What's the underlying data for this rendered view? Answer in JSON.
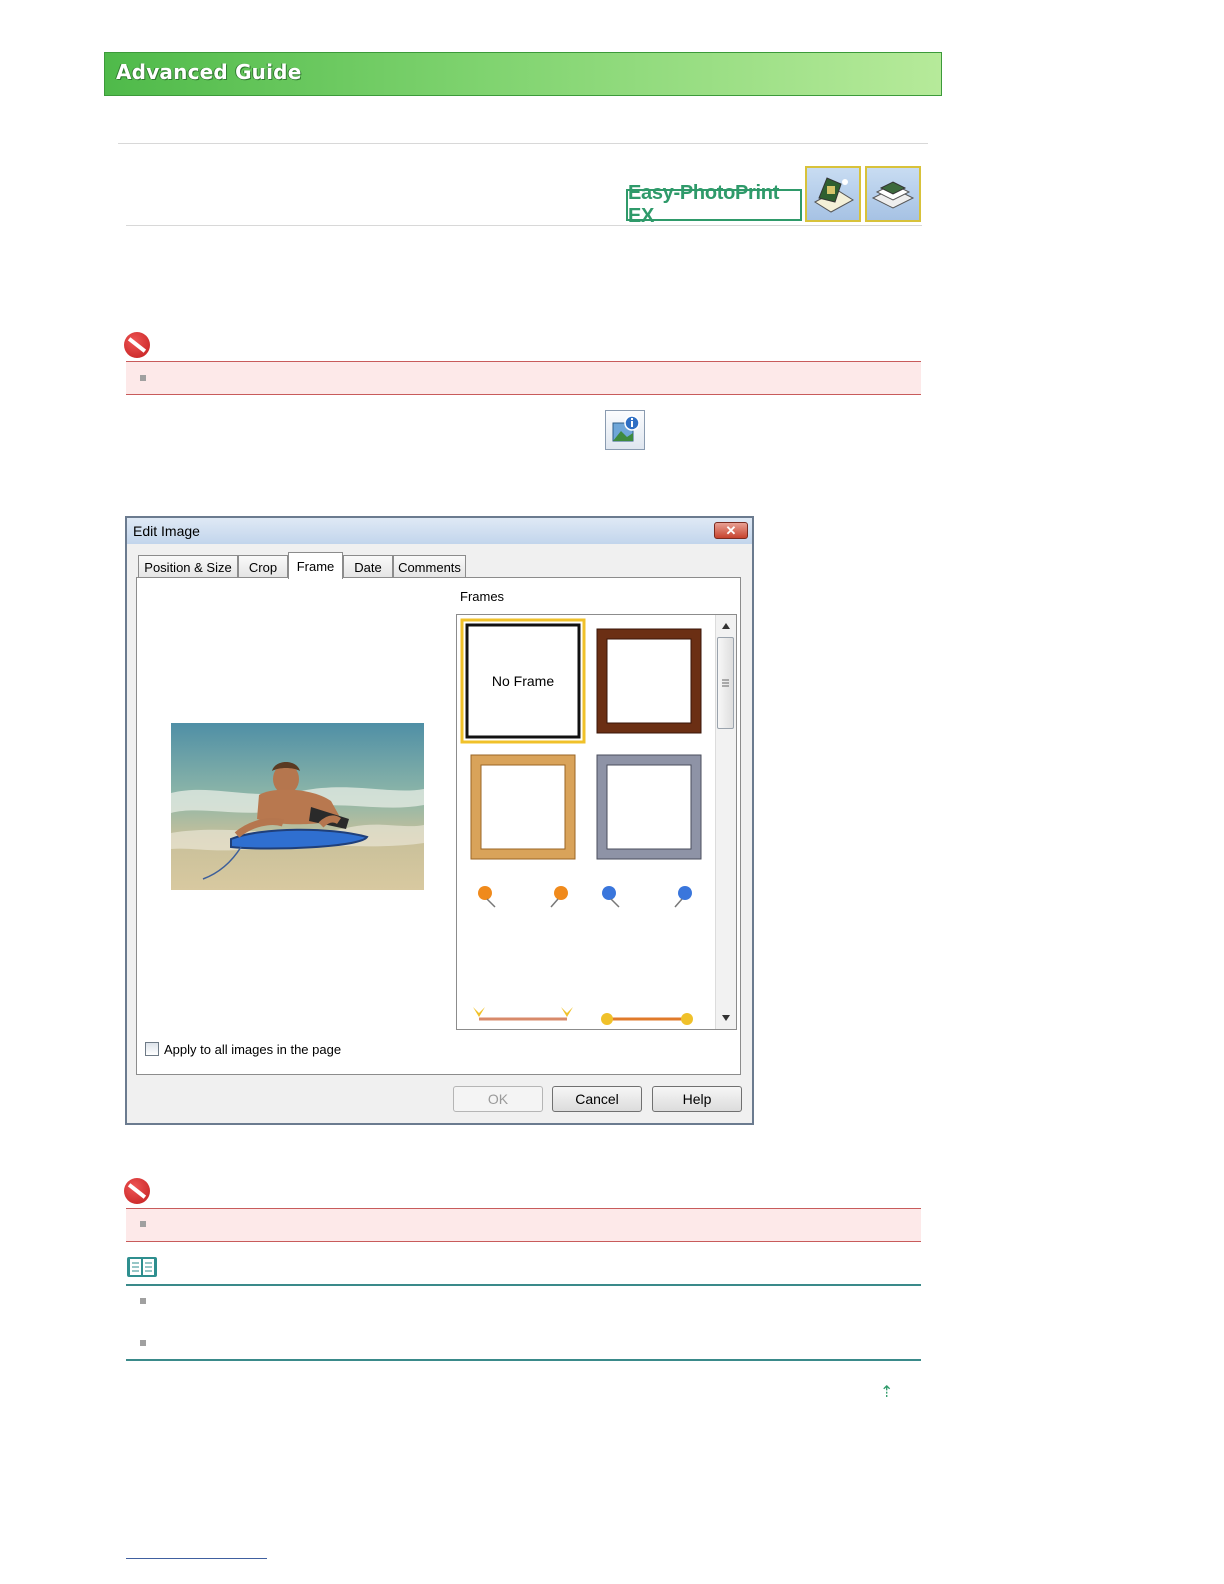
{
  "header": {
    "title": "Advanced Guide"
  },
  "product_badge": {
    "label": "Easy-PhotoPrint EX"
  },
  "dialog": {
    "title": "Edit Image",
    "close_glyph": "✕",
    "tabs": [
      {
        "label": "Position & Size",
        "active": false
      },
      {
        "label": "Crop",
        "active": false
      },
      {
        "label": "Frame",
        "active": true
      },
      {
        "label": "Date",
        "active": false
      },
      {
        "label": "Comments",
        "active": false
      }
    ],
    "frames_label": "Frames",
    "frame_items": [
      {
        "label": "No Frame",
        "selected": true
      }
    ],
    "apply_all_label": "Apply to all images in the page",
    "apply_all_checked": false,
    "buttons": {
      "ok": "OK",
      "cancel": "Cancel",
      "help": "Help"
    }
  },
  "page_top_link": {
    "glyph": "⇡"
  },
  "colors": {
    "banner_green": "#4fba4a",
    "badge_green": "#2f9a6a",
    "important_red": "#c21d1d",
    "warn_bg": "#fde9e9",
    "note_teal": "#3a8a8a"
  }
}
